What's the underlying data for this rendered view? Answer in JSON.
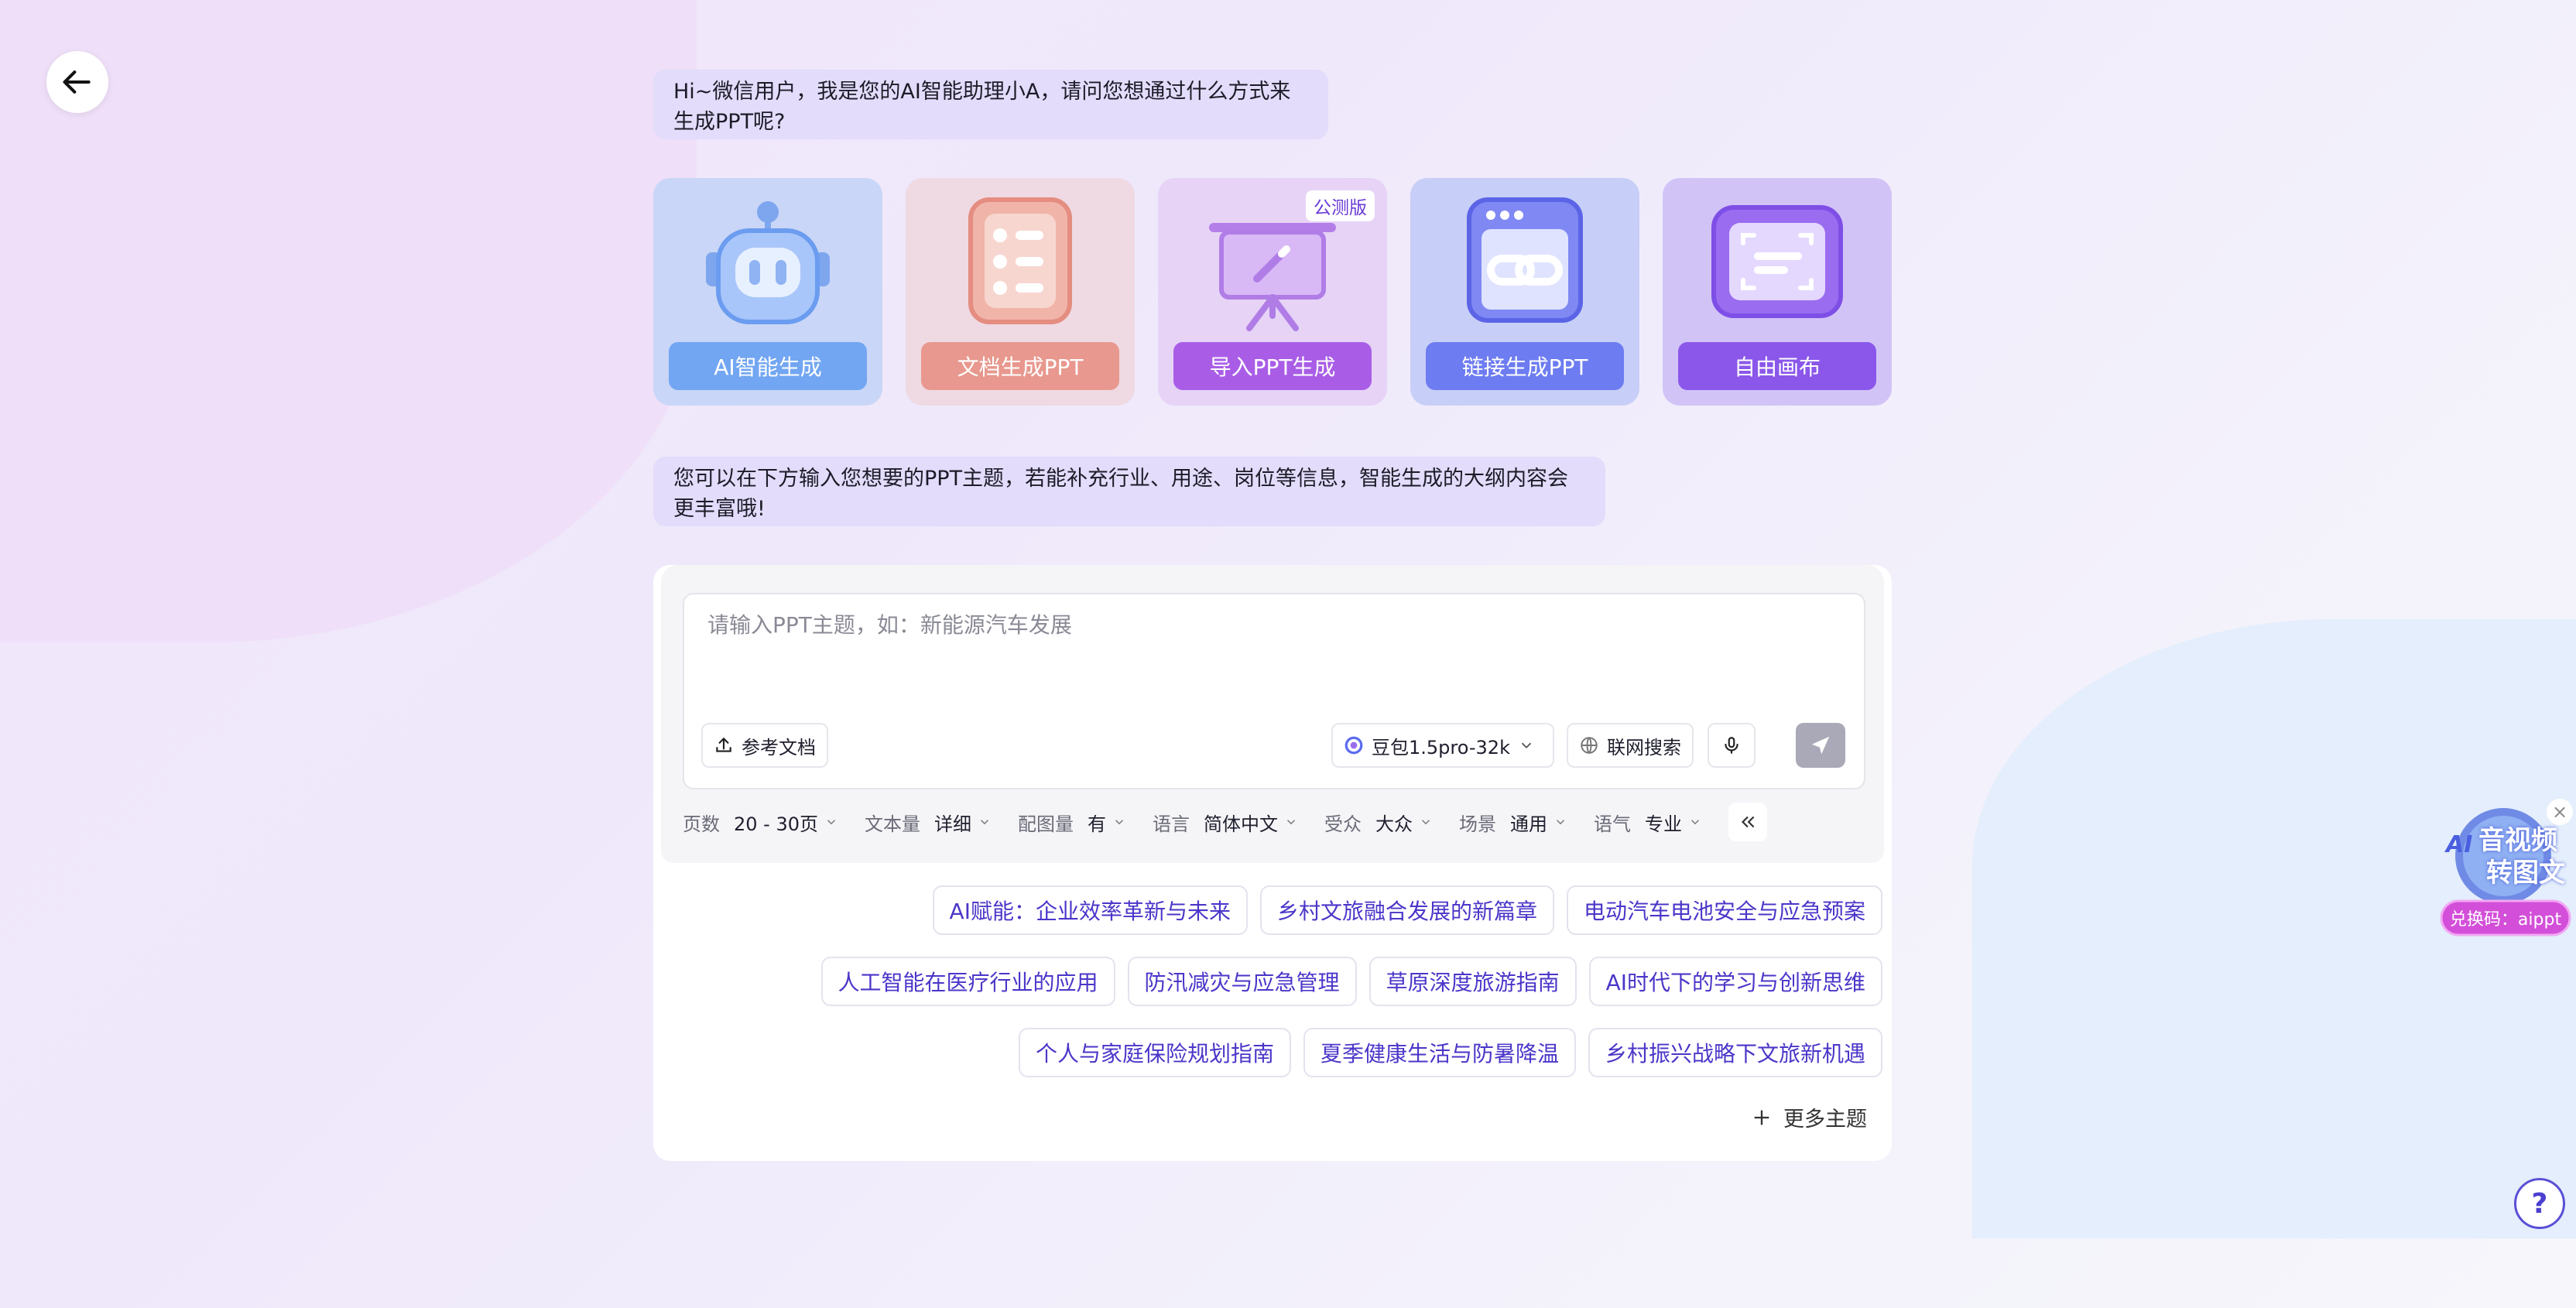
{
  "greeting": "Hi~微信用户，我是您的AI智能助理小A，请问您想通过什么方式来生成PPT呢?",
  "cards": [
    {
      "label": "AI智能生成",
      "icon": "robot-icon"
    },
    {
      "label": "文档生成PPT",
      "icon": "document-list-icon"
    },
    {
      "label": "导入PPT生成",
      "icon": "presentation-board-icon",
      "badge": "公测版"
    },
    {
      "label": "链接生成PPT",
      "icon": "link-window-icon"
    },
    {
      "label": "自由画布",
      "icon": "canvas-frame-icon"
    }
  ],
  "hint": "您可以在下方输入您想要的PPT主题，若能补充行业、用途、岗位等信息，智能生成的大纲内容会更丰富哦!",
  "input": {
    "placeholder": "请输入PPT主题，如：新能源汽车发展",
    "value": ""
  },
  "toolbar": {
    "ref_doc": "参考文档",
    "model": "豆包1.5pro-32k",
    "web_search": "联网搜索"
  },
  "settings": [
    {
      "key": "页数",
      "value": "20 - 30页"
    },
    {
      "key": "文本量",
      "value": "详细"
    },
    {
      "key": "配图量",
      "value": "有"
    },
    {
      "key": "语言",
      "value": "简体中文"
    },
    {
      "key": "受众",
      "value": "大众"
    },
    {
      "key": "场景",
      "value": "通用"
    },
    {
      "key": "语气",
      "value": "专业"
    }
  ],
  "topics": [
    [
      "AI赋能：企业效率革新与未来",
      "乡村文旅融合发展的新篇章",
      "电动汽车电池安全与应急预案"
    ],
    [
      "人工智能在医疗行业的应用",
      "防汛减灾与应急管理",
      "草原深度旅游指南",
      "AI时代下的学习与创新思维"
    ],
    [
      "个人与家庭保险规划指南",
      "夏季健康生活与防暑降温",
      "乡村振兴战略下文旅新机遇"
    ]
  ],
  "more_topics": "更多主题",
  "promo": {
    "line1": "音视频",
    "line2": "转图文",
    "code": "兑换码：aippt"
  },
  "colors": {
    "card_bg": [
      "#c9d6f7",
      "#efd9e3",
      "#e6d3f6",
      "#c7cef7",
      "#d2c3f7"
    ],
    "card_label": [
      "#72a6f2",
      "#e8988e",
      "#a95de6",
      "#6d7cf0",
      "#8a57ea"
    ]
  }
}
